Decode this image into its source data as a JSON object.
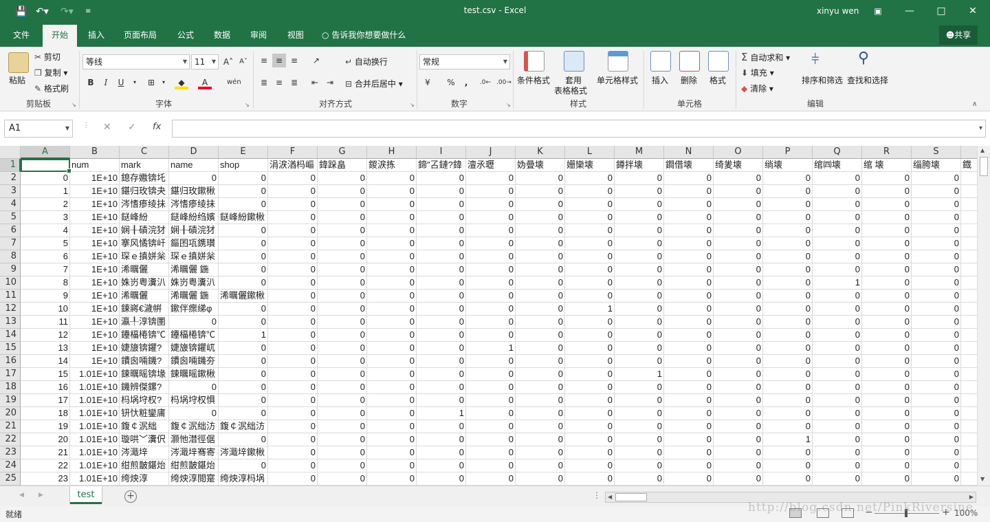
{
  "window": {
    "title": "test.csv  -  Excel",
    "user": "xinyu wen",
    "undo_icon": "undo-icon",
    "redo_icon": "redo-icon"
  },
  "tabs": [
    "文件",
    "开始",
    "插入",
    "页面布局",
    "公式",
    "数据",
    "审阅",
    "视图"
  ],
  "tell_me": "告诉我你想要做什么",
  "share": "共享",
  "ribbon": {
    "clipboard": {
      "paste": "粘贴",
      "cut": "剪切",
      "copy": "复制",
      "format_painter": "格式刷",
      "label": "剪贴板"
    },
    "font": {
      "name": "等线",
      "size": "11",
      "label": "字体",
      "bold": "B",
      "italic": "I",
      "underline": "U",
      "phonetic": "wén"
    },
    "alignment": {
      "wrap": "自动换行",
      "merge": "合并后居中",
      "label": "对齐方式"
    },
    "number": {
      "format": "常规",
      "label": "数字",
      "percent": "%",
      "comma": ","
    },
    "styles": {
      "conditional": "条件格式",
      "table1": "套用",
      "table2": "表格格式",
      "cell_styles": "单元格样式",
      "label": "样式"
    },
    "cells": {
      "insert": "插入",
      "delete": "删除",
      "format": "格式",
      "label": "单元格"
    },
    "editing": {
      "autosum": "自动求和",
      "fill": "填充",
      "clear": "清除",
      "sort": "排序和筛选",
      "find": "查找和选择",
      "label": "编辑"
    }
  },
  "formula_bar": {
    "name_box": "A1",
    "fx": "fx",
    "value": ""
  },
  "columns": [
    "A",
    "B",
    "C",
    "D",
    "E",
    "F",
    "G",
    "H",
    "I",
    "J",
    "K",
    "L",
    "M",
    "N",
    "O",
    "P",
    "Q",
    "R",
    "S"
  ],
  "rows": [
    [
      "",
      "num",
      "mark",
      "name",
      "shop",
      "涓涙湭杩嶇",
      "鍏跺畠",
      "鍐涙拣",
      "鍗″叾鏈?鍏",
      "澶氶瓑",
      "妫曡壊",
      "姗欒壊",
      "鐏拌壊",
      "鐧借壊",
      "绮夎壊",
      "绱壊",
      "绾㈣壊",
      "绾   壊",
      "缁胯壊",
      "鐡"
    ],
    [
      "0",
      "1E+10",
      "鎴存嫐锛圫",
      "0",
      "0",
      "0",
      "0",
      "0",
      "0",
      "0",
      "0",
      "0",
      "0",
      "0",
      "0",
      "0",
      "0",
      "0",
      "0"
    ],
    [
      "1",
      "1E+10",
      "鍖归玫锛夬",
      "鍖归玫鏉楸",
      "0",
      "0",
      "0",
      "0",
      "0",
      "0",
      "0",
      "0",
      "0",
      "0",
      "0",
      "0",
      "0",
      "0",
      "0"
    ],
    [
      "2",
      "1E+10",
      "涔愭瘆绫抺",
      "涔愭瘆绫抺",
      "0",
      "0",
      "0",
      "0",
      "0",
      "0",
      "0",
      "0",
      "0",
      "0",
      "0",
      "0",
      "0",
      "0",
      "0"
    ],
    [
      "3",
      "1E+10",
      "鎹峰紛",
      "鎹峰紛绉嬪",
      "鎹峰紛鏉楸",
      "0",
      "0",
      "0",
      "0",
      "0",
      "0",
      "0",
      "0",
      "0",
      "0",
      "0",
      "0",
      "0",
      "0"
    ],
    [
      "4",
      "1E+10",
      "娴╂磧浣犲",
      "娴╂磧浣犲",
      "0",
      "0",
      "0",
      "0",
      "0",
      "0",
      "0",
      "0",
      "0",
      "0",
      "0",
      "0",
      "0",
      "0",
      "0"
    ],
    [
      "5",
      "1E+10",
      "搴风憰锛屽",
      "鏂囨瓨鎸瓉",
      "0",
      "0",
      "0",
      "0",
      "0",
      "0",
      "0",
      "0",
      "0",
      "0",
      "0",
      "0",
      "0",
      "0",
      "0"
    ],
    [
      "6",
      "1E+10",
      "琛ｅ搷姘枀",
      "琛ｅ搷姘枀",
      "0",
      "0",
      "0",
      "0",
      "0",
      "0",
      "0",
      "0",
      "0",
      "0",
      "0",
      "0",
      "0",
      "0",
      "0"
    ],
    [
      "7",
      "1E+10",
      "浠曞儷",
      "浠曞儷 鍦",
      "0",
      "0",
      "0",
      "0",
      "0",
      "0",
      "0",
      "0",
      "0",
      "0",
      "0",
      "0",
      "0",
      "0",
      "0"
    ],
    [
      "8",
      "1E+10",
      "姝岃粤瀵汃",
      "姝岃粤瀵汃",
      "0",
      "0",
      "0",
      "0",
      "0",
      "0",
      "0",
      "0",
      "0",
      "0",
      "0",
      "0",
      "1",
      "0",
      "0"
    ],
    [
      "9",
      "1E+10",
      "浠曞儷",
      "浠曞儷 鍦",
      "浠曞儷鏉楸",
      "0",
      "0",
      "0",
      "0",
      "0",
      "0",
      "0",
      "0",
      "0",
      "0",
      "0",
      "0",
      "0",
      "0"
    ],
    [
      "10",
      "1E+10",
      "鍊嶈€濊帲",
      "鏉伴瘝绨φ",
      "0",
      "0",
      "0",
      "0",
      "0",
      "0",
      "0",
      "1",
      "0",
      "0",
      "0",
      "0",
      "0",
      "0",
      "0"
    ],
    [
      "11",
      "1E+10",
      "瀛╀淳锛圛",
      "0",
      "0",
      "0",
      "0",
      "0",
      "0",
      "0",
      "0",
      "0",
      "0",
      "0",
      "0",
      "0",
      "0",
      "0",
      "0"
    ],
    [
      "12",
      "1E+10",
      "鑸楅棬锛℃",
      "鑸楅棬锛℃",
      "1",
      "0",
      "0",
      "0",
      "0",
      "0",
      "0",
      "0",
      "0",
      "0",
      "0",
      "0",
      "0",
      "0",
      "0"
    ],
    [
      "13",
      "1E+10",
      "婕旇锛鑺?",
      "婕旇锛鑺屼",
      "0",
      "0",
      "0",
      "0",
      "0",
      "1",
      "0",
      "0",
      "0",
      "0",
      "0",
      "0",
      "0",
      "0",
      "0"
    ],
    [
      "14",
      "1E+10",
      "鐨囪啢鐖?",
      "鐨囪啢鐖夯",
      "0",
      "0",
      "0",
      "0",
      "0",
      "0",
      "0",
      "0",
      "0",
      "0",
      "0",
      "0",
      "0",
      "0",
      "0"
    ],
    [
      "15",
      "1.01E+10",
      "鍊曞暚锛堟",
      "鍊曞暚鏉楸",
      "0",
      "0",
      "0",
      "0",
      "0",
      "0",
      "0",
      "0",
      "1",
      "0",
      "0",
      "0",
      "0",
      "0",
      "0"
    ],
    [
      "16",
      "1.01E+10",
      "鐖辨傑鏍?",
      "0",
      "0",
      "0",
      "0",
      "0",
      "0",
      "0",
      "0",
      "0",
      "0",
      "0",
      "0",
      "0",
      "0",
      "0",
      "0"
    ],
    [
      "17",
      "1.01E+10",
      "杩埚垨权?",
      "杩埚垨权惧",
      "0",
      "0",
      "0",
      "0",
      "0",
      "0",
      "0",
      "0",
      "0",
      "0",
      "0",
      "0",
      "0",
      "0",
      "0"
    ],
    [
      "18",
      "1.01E+10",
      "钘忕粧鑾庯",
      "0",
      "0",
      "0",
      "0",
      "0",
      "1",
      "0",
      "0",
      "0",
      "0",
      "0",
      "0",
      "0",
      "0",
      "0",
      "0"
    ],
    [
      "19",
      "1.01E+10",
      "鍑￠泦绌",
      "鍑￠泦绌汸",
      "鍑￠泦绌汸",
      "0",
      "0",
      "0",
      "0",
      "0",
      "0",
      "0",
      "0",
      "0",
      "0",
      "0",
      "0",
      "0",
      "0"
    ],
    [
      "20",
      "1.01E+10",
      "璇哄﹀瀵伬",
      "灏忚澘徑倨",
      "0",
      "0",
      "0",
      "0",
      "0",
      "0",
      "0",
      "0",
      "0",
      "0",
      "0",
      "1",
      "0",
      "0",
      "0"
    ],
    [
      "21",
      "1.01E+10",
      "涔濈垶",
      "涔濈垶骞寄",
      "涔濈垶鏉楸",
      "0",
      "0",
      "0",
      "0",
      "0",
      "0",
      "0",
      "0",
      "0",
      "0",
      "0",
      "0",
      "0",
      "0"
    ],
    [
      "22",
      "1.01E+10",
      "绀煎皵鍖炲",
      "绀煎皵鍖炲",
      "0",
      "0",
      "0",
      "0",
      "0",
      "0",
      "0",
      "0",
      "0",
      "0",
      "0",
      "0",
      "0",
      "0",
      "0"
    ],
    [
      "23",
      "1.01E+10",
      "绔炴淳",
      "绔炴淳閲寔",
      "绔炴淳杩埚",
      "0",
      "0",
      "0",
      "0",
      "0",
      "0",
      "0",
      "0",
      "0",
      "0",
      "0",
      "0",
      "0",
      "0"
    ]
  ],
  "sheet_tab": "test",
  "status": {
    "ready": "就绪",
    "zoom": "100%"
  },
  "watermark": "http://blog.csdn.net/PinkRiversine"
}
